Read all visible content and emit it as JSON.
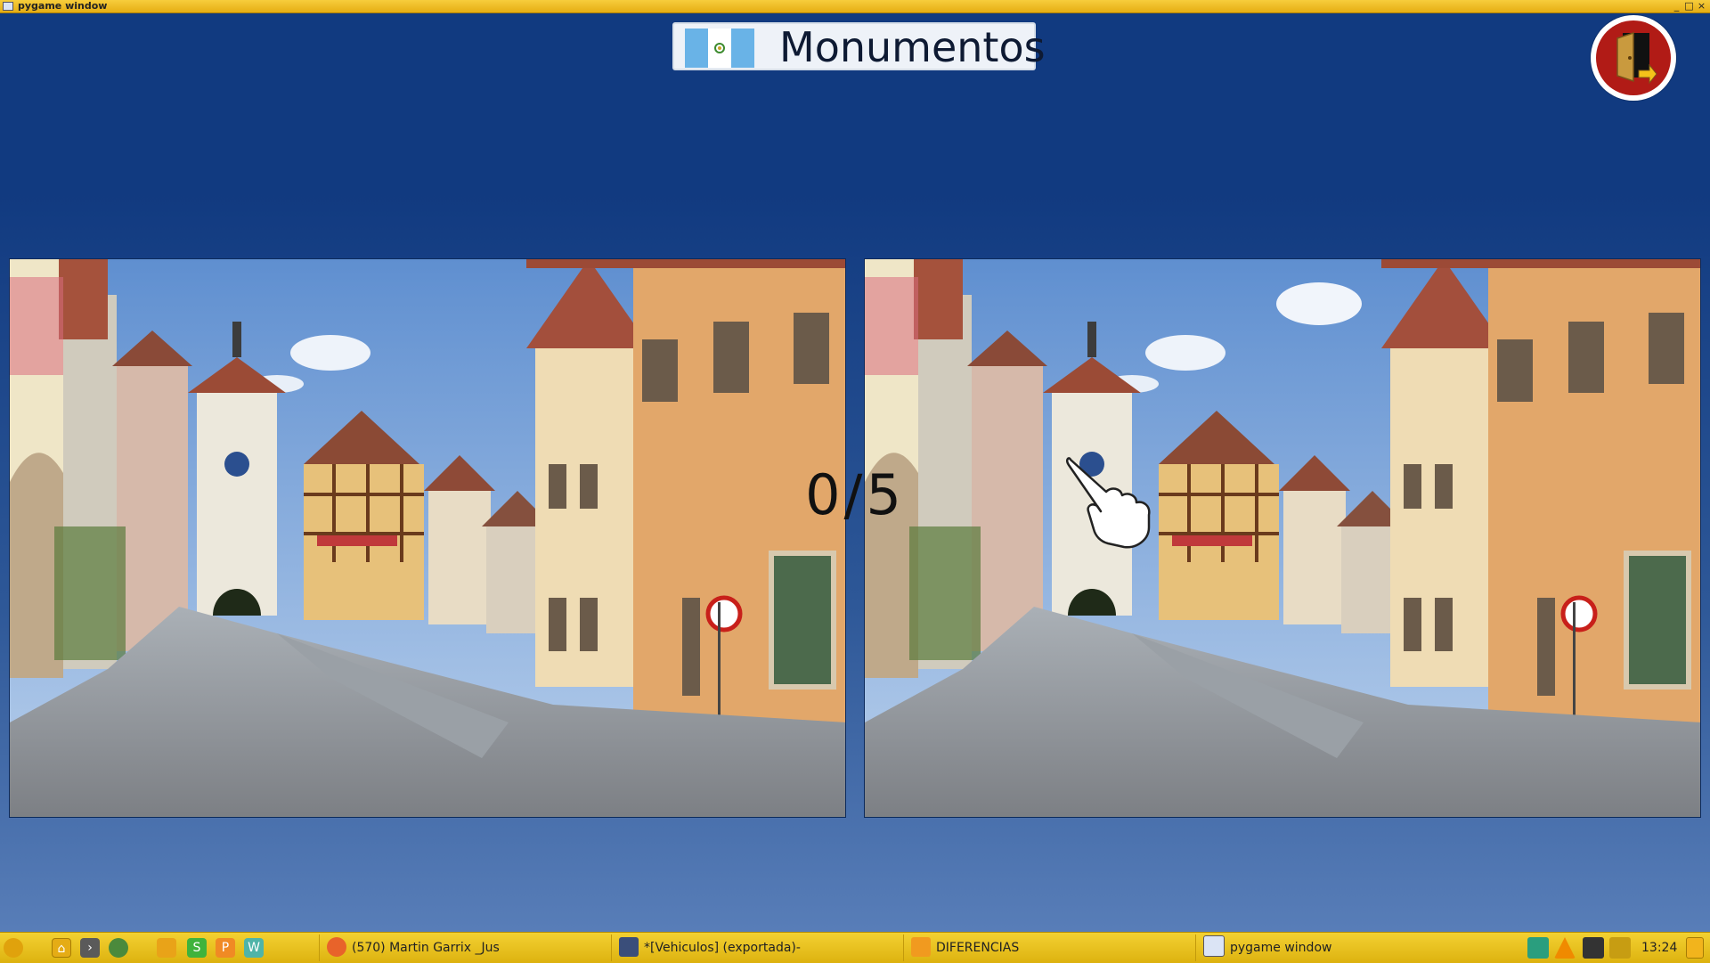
{
  "window": {
    "title": "pygame window",
    "controls": [
      "_",
      "□",
      "×"
    ]
  },
  "game": {
    "title": "Monumentos",
    "score_found": 0,
    "score_separator": "/",
    "score_total": 5,
    "flag_icon": "guatemala-flag-icon",
    "exit_icon": "exit-door-icon",
    "cursor_icon": "pointing-hand-cursor-icon"
  },
  "taskbar": {
    "launchers": [
      "menu-icon",
      "home-icon",
      "terminal-icon",
      "globe-icon",
      "scratch-icon",
      "spreadsheet-icon",
      "presentation-icon",
      "writer-icon"
    ],
    "tasks": [
      {
        "label": "(570) Martin Garrix _Jus",
        "icon": "firefox-icon"
      },
      {
        "label": "*[Vehiculos] (exportada)-",
        "icon": "image-editor-icon"
      },
      {
        "label": "DIFERENCIAS",
        "icon": "folder-icon"
      },
      {
        "label": "pygame window",
        "icon": "window-icon"
      }
    ],
    "tray": [
      "sync-icon",
      "vlc-icon",
      "network-icon",
      "volume-icon"
    ],
    "clock": "13:24"
  }
}
